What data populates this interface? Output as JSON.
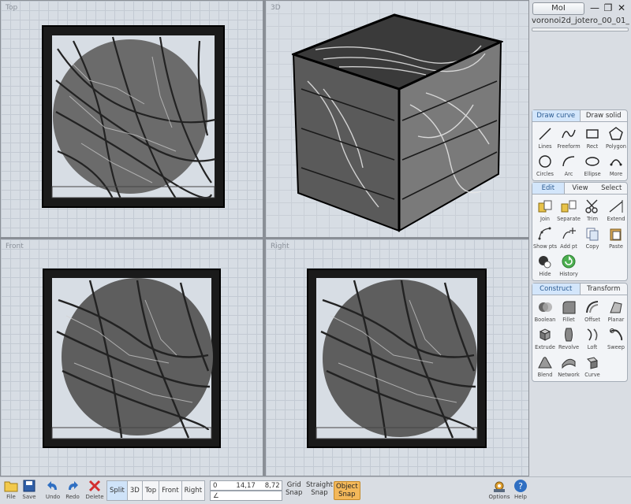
{
  "viewports": {
    "top": "Top",
    "three_d": "3D",
    "front": "Front",
    "right": "Right"
  },
  "panel": {
    "app_button": "MoI",
    "filename": "voronoi2d_jotero_00_01_...",
    "window_icons": [
      "minimize-icon",
      "restore-icon",
      "close-icon"
    ],
    "draw": {
      "tabs": [
        "Draw curve",
        "Draw solid"
      ],
      "active_tab": "Draw curve",
      "tools": [
        "Lines",
        "Freeform",
        "Rect",
        "Polygon",
        "Circles",
        "Arc",
        "Ellipse",
        "More"
      ]
    },
    "edit": {
      "tabs": [
        "Edit",
        "View",
        "Select"
      ],
      "active_tab": "Edit",
      "tools": [
        "Join",
        "Separate",
        "Trim",
        "Extend",
        "Show pts",
        "Add pt",
        "Copy",
        "Paste",
        "Hide",
        "History"
      ]
    },
    "construct": {
      "tabs": [
        "Construct",
        "Transform"
      ],
      "active_tab": "Construct",
      "tools": [
        "Boolean",
        "Fillet",
        "Offset",
        "Planar",
        "Extrude",
        "Revolve",
        "Loft",
        "Sweep",
        "Blend",
        "Network",
        "Curve"
      ]
    }
  },
  "bottom": {
    "file_buttons": [
      "File",
      "Save",
      "Undo",
      "Redo",
      "Delete"
    ],
    "view_tabs": [
      "Split",
      "3D",
      "Top",
      "Front",
      "Right"
    ],
    "active_view": "Split",
    "coords": {
      "x": "0",
      "y": "14,17",
      "z": "8,72"
    },
    "grid_snap": [
      "Grid",
      "Snap"
    ],
    "straight_snap": [
      "Straight",
      "Snap"
    ],
    "object_snap": [
      "Object",
      "Snap"
    ],
    "right_buttons": [
      "Options",
      "Help"
    ]
  },
  "colors": {
    "viewport_bg": "#d7dde4",
    "active_tab": "#d3e6fb",
    "object_snap_active": "#f3b85a"
  }
}
